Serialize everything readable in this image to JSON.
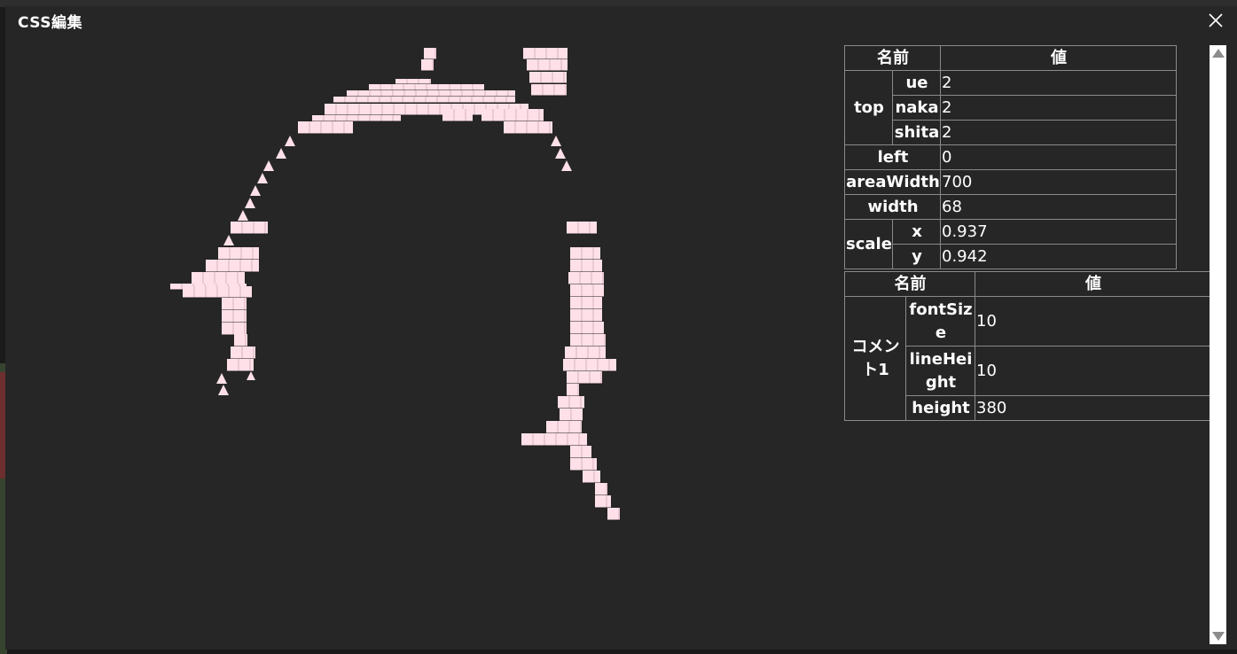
{
  "dialog": {
    "title": "CSS編集",
    "close_icon": "close-icon"
  },
  "colors": {
    "dialog_bg": "#262626",
    "art_fill": "#ffe0e8",
    "table_border": "#8a8a8a",
    "text": "#ffffff"
  },
  "table1": {
    "header_name": "名前",
    "header_value": "値",
    "top_label": "top",
    "ue_label": "ue",
    "ue_value": "2",
    "naka_label": "naka",
    "naka_value": "2",
    "shita_label": "shita",
    "shita_value": "2",
    "left_label": "left",
    "left_value": "0",
    "areaWidth_label": "areaWidth",
    "areaWidth_value": "700",
    "width_label": "width",
    "width_value": "68",
    "scale_label": "scale",
    "x_label": "x",
    "x_value": "0.937",
    "y_label": "y",
    "y_value": "0.942"
  },
  "table2": {
    "header_name": "名前",
    "header_value": "値",
    "comment_label": "コメント1",
    "fontSize_label": "fontSize",
    "fontSize_value": "10",
    "lineHeight_label": "lineHeight",
    "lineHeight_value": "10",
    "height_label": "height",
    "height_value": "380"
  }
}
